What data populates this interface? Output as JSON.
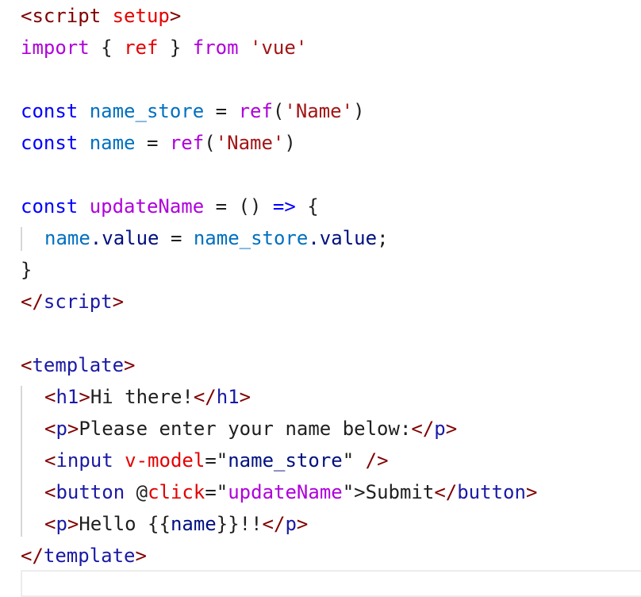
{
  "editor": {
    "language": "vue",
    "lines": [
      {
        "tokens": [
          {
            "t": "<",
            "c": "tok-angle"
          },
          {
            "t": "script",
            "c": "tok-tag-name"
          },
          {
            "t": " ",
            "c": "tok-plain"
          },
          {
            "t": "setup",
            "c": "tok-attr"
          },
          {
            "t": ">",
            "c": "tok-angle"
          }
        ]
      },
      {
        "tokens": [
          {
            "t": "import",
            "c": "tok-import"
          },
          {
            "t": " { ",
            "c": "tok-plain"
          },
          {
            "t": "ref",
            "c": "tok-attr"
          },
          {
            "t": " } ",
            "c": "tok-plain"
          },
          {
            "t": "from",
            "c": "tok-import"
          },
          {
            "t": " ",
            "c": "tok-plain"
          },
          {
            "t": "'vue'",
            "c": "tok-string"
          }
        ]
      },
      {
        "tokens": []
      },
      {
        "tokens": [
          {
            "t": "const",
            "c": "tok-keyword"
          },
          {
            "t": " ",
            "c": "tok-plain"
          },
          {
            "t": "name_store",
            "c": "tok-var"
          },
          {
            "t": " = ",
            "c": "tok-plain"
          },
          {
            "t": "ref",
            "c": "tok-ref"
          },
          {
            "t": "(",
            "c": "tok-plain"
          },
          {
            "t": "'Name'",
            "c": "tok-string"
          },
          {
            "t": ")",
            "c": "tok-plain"
          }
        ]
      },
      {
        "tokens": [
          {
            "t": "const",
            "c": "tok-keyword"
          },
          {
            "t": " ",
            "c": "tok-plain"
          },
          {
            "t": "name",
            "c": "tok-var"
          },
          {
            "t": " = ",
            "c": "tok-plain"
          },
          {
            "t": "ref",
            "c": "tok-ref"
          },
          {
            "t": "(",
            "c": "tok-plain"
          },
          {
            "t": "'Name'",
            "c": "tok-string"
          },
          {
            "t": ")",
            "c": "tok-plain"
          }
        ]
      },
      {
        "tokens": []
      },
      {
        "tokens": [
          {
            "t": "const",
            "c": "tok-keyword"
          },
          {
            "t": " ",
            "c": "tok-plain"
          },
          {
            "t": "updateName",
            "c": "tok-fnname"
          },
          {
            "t": " = () ",
            "c": "tok-plain"
          },
          {
            "t": "=>",
            "c": "tok-arrow"
          },
          {
            "t": " {",
            "c": "tok-plain"
          }
        ]
      },
      {
        "indent": 1,
        "block": "only",
        "tokens": [
          {
            "t": "name",
            "c": "tok-var"
          },
          {
            "t": ".value",
            "c": "tok-prop"
          },
          {
            "t": " = ",
            "c": "tok-plain"
          },
          {
            "t": "name_store",
            "c": "tok-var"
          },
          {
            "t": ".value",
            "c": "tok-prop"
          },
          {
            "t": ";",
            "c": "tok-plain"
          }
        ]
      },
      {
        "tokens": [
          {
            "t": "}",
            "c": "tok-plain"
          }
        ]
      },
      {
        "tokens": [
          {
            "t": "</",
            "c": "tok-angle"
          },
          {
            "t": "script",
            "c": "tok-html-tag-name"
          },
          {
            "t": ">",
            "c": "tok-angle"
          }
        ]
      },
      {
        "tokens": []
      },
      {
        "tokens": [
          {
            "t": "<",
            "c": "tok-angle"
          },
          {
            "t": "template",
            "c": "tok-html-tag-name"
          },
          {
            "t": ">",
            "c": "tok-angle"
          }
        ]
      },
      {
        "indent": 1,
        "block": "first",
        "tokens": [
          {
            "t": "<",
            "c": "tok-angle"
          },
          {
            "t": "h1",
            "c": "tok-html-tag-name"
          },
          {
            "t": ">",
            "c": "tok-angle"
          },
          {
            "t": "Hi there!",
            "c": "tok-text"
          },
          {
            "t": "</",
            "c": "tok-angle"
          },
          {
            "t": "h1",
            "c": "tok-html-tag-name"
          },
          {
            "t": ">",
            "c": "tok-angle"
          }
        ]
      },
      {
        "indent": 1,
        "tokens": [
          {
            "t": "<",
            "c": "tok-angle"
          },
          {
            "t": "p",
            "c": "tok-html-tag-name"
          },
          {
            "t": ">",
            "c": "tok-angle"
          },
          {
            "t": "Please enter your name below:",
            "c": "tok-text"
          },
          {
            "t": "</",
            "c": "tok-angle"
          },
          {
            "t": "p",
            "c": "tok-html-tag-name"
          },
          {
            "t": ">",
            "c": "tok-angle"
          }
        ]
      },
      {
        "indent": 1,
        "tokens": [
          {
            "t": "<",
            "c": "tok-angle"
          },
          {
            "t": "input",
            "c": "tok-html-tag-name"
          },
          {
            "t": " ",
            "c": "tok-plain"
          },
          {
            "t": "v-model",
            "c": "tok-attr"
          },
          {
            "t": "=\"",
            "c": "tok-plain"
          },
          {
            "t": "name_store",
            "c": "tok-prop"
          },
          {
            "t": "\" ",
            "c": "tok-plain"
          },
          {
            "t": "/>",
            "c": "tok-angle"
          }
        ]
      },
      {
        "indent": 1,
        "tokens": [
          {
            "t": "<",
            "c": "tok-angle"
          },
          {
            "t": "button",
            "c": "tok-html-tag-name"
          },
          {
            "t": " @",
            "c": "tok-plain"
          },
          {
            "t": "click",
            "c": "tok-attr"
          },
          {
            "t": "=\"",
            "c": "tok-plain"
          },
          {
            "t": "updateName",
            "c": "tok-attrval-fn"
          },
          {
            "t": "\">",
            "c": "tok-plain"
          },
          {
            "t": "Submit",
            "c": "tok-text"
          },
          {
            "t": "</",
            "c": "tok-angle"
          },
          {
            "t": "button",
            "c": "tok-html-tag-name"
          },
          {
            "t": ">",
            "c": "tok-angle"
          }
        ]
      },
      {
        "indent": 1,
        "block": "last",
        "tokens": [
          {
            "t": "<",
            "c": "tok-angle"
          },
          {
            "t": "p",
            "c": "tok-html-tag-name"
          },
          {
            "t": ">",
            "c": "tok-angle"
          },
          {
            "t": "Hello {{",
            "c": "tok-text"
          },
          {
            "t": "name",
            "c": "tok-prop"
          },
          {
            "t": "}}!!",
            "c": "tok-text"
          },
          {
            "t": "</",
            "c": "tok-angle"
          },
          {
            "t": "p",
            "c": "tok-html-tag-name"
          },
          {
            "t": ">",
            "c": "tok-angle"
          }
        ]
      },
      {
        "tokens": [
          {
            "t": "</",
            "c": "tok-angle"
          },
          {
            "t": "template",
            "c": "tok-html-tag-name"
          },
          {
            "t": ">",
            "c": "tok-angle"
          }
        ]
      }
    ]
  }
}
